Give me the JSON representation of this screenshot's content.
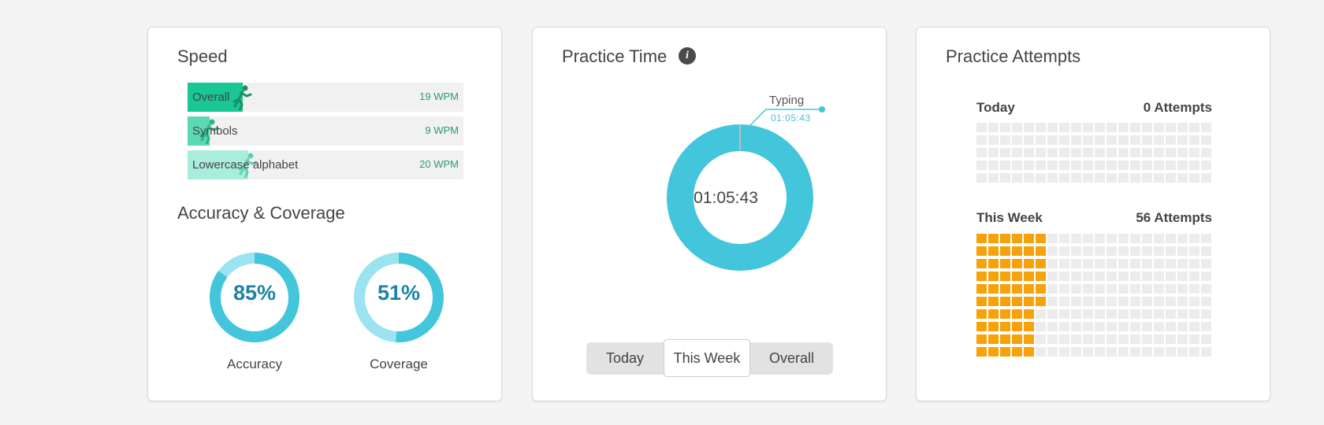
{
  "speed": {
    "title": "Speed",
    "rows": [
      {
        "label": "Overall",
        "value": "19 WPM",
        "fill": 0.2,
        "color": "#19c794"
      },
      {
        "label": "Symbols",
        "value": "9 WPM",
        "fill": 0.08,
        "color": "#5ad9b4"
      },
      {
        "label": "Lowercase alphabet",
        "value": "20 WPM",
        "fill": 0.22,
        "color": "#a9eedd"
      }
    ]
  },
  "accuracy": {
    "title": "Accuracy & Coverage",
    "accuracy_label": "Accuracy",
    "accuracy_value": "85%",
    "accuracy_percent": 85,
    "coverage_label": "Coverage",
    "coverage_value": "51%",
    "coverage_percent": 51,
    "ring_color": "#43c6dc",
    "ring_track": "#9be3f0",
    "text_color": "#1d82a6"
  },
  "practice_time": {
    "title": "Practice Time",
    "info_icon": "info-icon",
    "center_value": "01:05:43",
    "callout_title": "Typing",
    "callout_value": "01:05:43",
    "ring_color": "#43c6dc",
    "tabs": [
      "Today",
      "This Week",
      "Overall"
    ],
    "active_tab": "This Week"
  },
  "attempts": {
    "title": "Practice Attempts",
    "today_label": "Today",
    "today_value": "0 Attempts",
    "today_count": 0,
    "week_label": "This Week",
    "week_value": "56 Attempts",
    "week_count": 56,
    "filled_color": "#f7a10b",
    "empty_color": "#ececec"
  }
}
